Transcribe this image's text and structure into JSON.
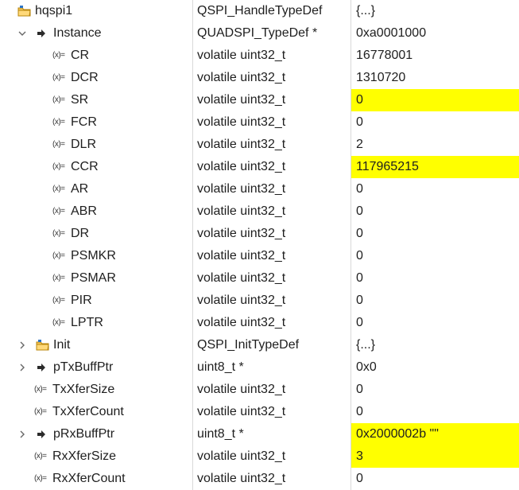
{
  "rows": [
    {
      "key": "hqspi1",
      "name": "hqspi1",
      "type": "QSPI_HandleTypeDef",
      "value": "{...}",
      "indent": 0,
      "twisty": "",
      "icon": "struct",
      "changed": false
    },
    {
      "key": "instance",
      "name": "Instance",
      "type": "QUADSPI_TypeDef *",
      "value": "0xa0001000",
      "indent": 1,
      "twisty": "expanded",
      "icon": "pointer",
      "changed": false
    },
    {
      "key": "cr",
      "name": "CR",
      "type": "volatile uint32_t",
      "value": "16778001",
      "indent": 2,
      "twisty": "",
      "icon": "variable",
      "changed": false
    },
    {
      "key": "dcr",
      "name": "DCR",
      "type": "volatile uint32_t",
      "value": "1310720",
      "indent": 2,
      "twisty": "",
      "icon": "variable",
      "changed": false
    },
    {
      "key": "sr",
      "name": "SR",
      "type": "volatile uint32_t",
      "value": "0",
      "indent": 2,
      "twisty": "",
      "icon": "variable",
      "changed": true
    },
    {
      "key": "fcr",
      "name": "FCR",
      "type": "volatile uint32_t",
      "value": "0",
      "indent": 2,
      "twisty": "",
      "icon": "variable",
      "changed": false
    },
    {
      "key": "dlr",
      "name": "DLR",
      "type": "volatile uint32_t",
      "value": "2",
      "indent": 2,
      "twisty": "",
      "icon": "variable",
      "changed": false
    },
    {
      "key": "ccr",
      "name": "CCR",
      "type": "volatile uint32_t",
      "value": "117965215",
      "indent": 2,
      "twisty": "",
      "icon": "variable",
      "changed": true
    },
    {
      "key": "ar",
      "name": "AR",
      "type": "volatile uint32_t",
      "value": "0",
      "indent": 2,
      "twisty": "",
      "icon": "variable",
      "changed": false
    },
    {
      "key": "abr",
      "name": "ABR",
      "type": "volatile uint32_t",
      "value": "0",
      "indent": 2,
      "twisty": "",
      "icon": "variable",
      "changed": false
    },
    {
      "key": "dr",
      "name": "DR",
      "type": "volatile uint32_t",
      "value": "0",
      "indent": 2,
      "twisty": "",
      "icon": "variable",
      "changed": false
    },
    {
      "key": "psmkr",
      "name": "PSMKR",
      "type": "volatile uint32_t",
      "value": "0",
      "indent": 2,
      "twisty": "",
      "icon": "variable",
      "changed": false
    },
    {
      "key": "psmar",
      "name": "PSMAR",
      "type": "volatile uint32_t",
      "value": "0",
      "indent": 2,
      "twisty": "",
      "icon": "variable",
      "changed": false
    },
    {
      "key": "pir",
      "name": "PIR",
      "type": "volatile uint32_t",
      "value": "0",
      "indent": 2,
      "twisty": "",
      "icon": "variable",
      "changed": false
    },
    {
      "key": "lptr",
      "name": "LPTR",
      "type": "volatile uint32_t",
      "value": "0",
      "indent": 2,
      "twisty": "",
      "icon": "variable",
      "changed": false
    },
    {
      "key": "init",
      "name": "Init",
      "type": "QSPI_InitTypeDef",
      "value": "{...}",
      "indent": 1,
      "twisty": "collapsed",
      "icon": "struct",
      "changed": false
    },
    {
      "key": "ptxbuffptr",
      "name": "pTxBuffPtr",
      "type": "uint8_t *",
      "value": "0x0",
      "indent": 1,
      "twisty": "collapsed",
      "icon": "pointer",
      "changed": false
    },
    {
      "key": "txxfersize",
      "name": "TxXferSize",
      "type": "volatile uint32_t",
      "value": "0",
      "indent": 1,
      "twisty": "",
      "icon": "variable",
      "changed": false
    },
    {
      "key": "txxfercount",
      "name": "TxXferCount",
      "type": "volatile uint32_t",
      "value": "0",
      "indent": 1,
      "twisty": "",
      "icon": "variable",
      "changed": false
    },
    {
      "key": "prxbuffptr",
      "name": "pRxBuffPtr",
      "type": "uint8_t *",
      "value": "0x2000002b \"\"",
      "indent": 1,
      "twisty": "collapsed",
      "icon": "pointer",
      "changed": true
    },
    {
      "key": "rxxfersize",
      "name": "RxXferSize",
      "type": "volatile uint32_t",
      "value": "3",
      "indent": 1,
      "twisty": "",
      "icon": "variable",
      "changed": true
    },
    {
      "key": "rxxfercount",
      "name": "RxXferCount",
      "type": "volatile uint32_t",
      "value": "0",
      "indent": 1,
      "twisty": "",
      "icon": "variable",
      "changed": false
    }
  ],
  "colors": {
    "changed_highlight": "#ffff00",
    "column_divider": "#d9d9d9",
    "text": "#1e1e1e"
  },
  "icons": {
    "struct": "folder-icon",
    "pointer": "pointer-arrow-icon",
    "variable": "variable-x-icon",
    "expanded": "chevron-down-icon",
    "collapsed": "chevron-right-icon"
  }
}
